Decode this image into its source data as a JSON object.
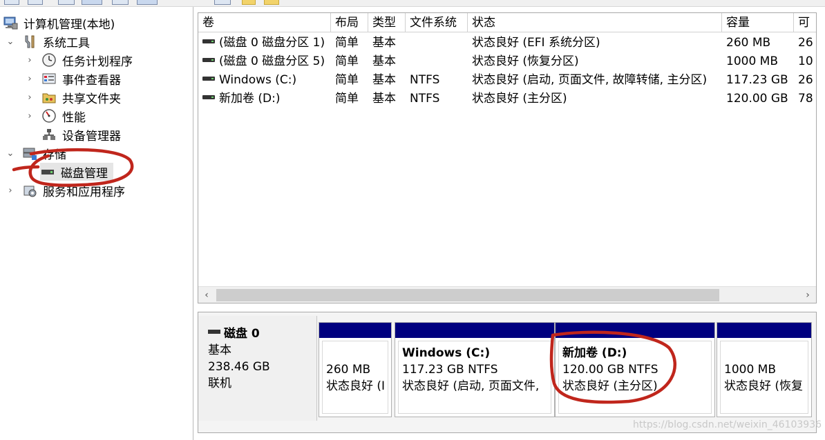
{
  "toolbar": {
    "buttons": [
      "back",
      "forward",
      "up",
      "show-hide",
      "properties",
      "help",
      "refresh",
      "export"
    ]
  },
  "tree": {
    "root_label": "计算机管理(本地)",
    "system_tools": {
      "label": "系统工具",
      "items": [
        {
          "label": "任务计划程序",
          "icon": "clock-icon"
        },
        {
          "label": "事件查看器",
          "icon": "event-viewer-icon"
        },
        {
          "label": "共享文件夹",
          "icon": "shared-folder-icon"
        },
        {
          "label": "性能",
          "icon": "performance-icon"
        },
        {
          "label": "设备管理器",
          "icon": "device-manager-icon"
        }
      ]
    },
    "storage": {
      "label": "存储",
      "disk_management": "磁盘管理"
    },
    "services": {
      "label": "服务和应用程序"
    }
  },
  "volumes": {
    "headers": [
      "卷",
      "布局",
      "类型",
      "文件系统",
      "状态",
      "容量",
      "可"
    ],
    "rows": [
      {
        "name": "(磁盘 0 磁盘分区 1)",
        "layout": "简单",
        "type": "基本",
        "fs": "",
        "status": "状态良好 (EFI 系统分区)",
        "capacity": "260 MB",
        "free": "26"
      },
      {
        "name": "(磁盘 0 磁盘分区 5)",
        "layout": "简单",
        "type": "基本",
        "fs": "",
        "status": "状态良好 (恢复分区)",
        "capacity": "1000 MB",
        "free": "10"
      },
      {
        "name": "Windows (C:)",
        "layout": "简单",
        "type": "基本",
        "fs": "NTFS",
        "status": "状态良好 (启动, 页面文件, 故障转储, 主分区)",
        "capacity": "117.23 GB",
        "free": "26"
      },
      {
        "name": "新加卷 (D:)",
        "layout": "简单",
        "type": "基本",
        "fs": "NTFS",
        "status": "状态良好 (主分区)",
        "capacity": "120.00 GB",
        "free": "78"
      }
    ]
  },
  "disk": {
    "name": "磁盘 0",
    "kind": "基本",
    "size": "238.46 GB",
    "state": "联机",
    "partitions": [
      {
        "title": "",
        "line1": "260 MB",
        "line2": "状态良好 (I"
      },
      {
        "title": "Windows  (C:)",
        "line1": "117.23 GB NTFS",
        "line2": "状态良好 (启动, 页面文件,"
      },
      {
        "title": "新加卷  (D:)",
        "line1": "120.00 GB NTFS",
        "line2": "状态良好 (主分区)"
      },
      {
        "title": "",
        "line1": "1000 MB",
        "line2": "状态良好 (恢复"
      }
    ]
  },
  "watermark": "https://blog.csdn.net/weixin_46103936",
  "colors": {
    "partition_bar": "#00007f",
    "annotation": "#c0261c"
  }
}
